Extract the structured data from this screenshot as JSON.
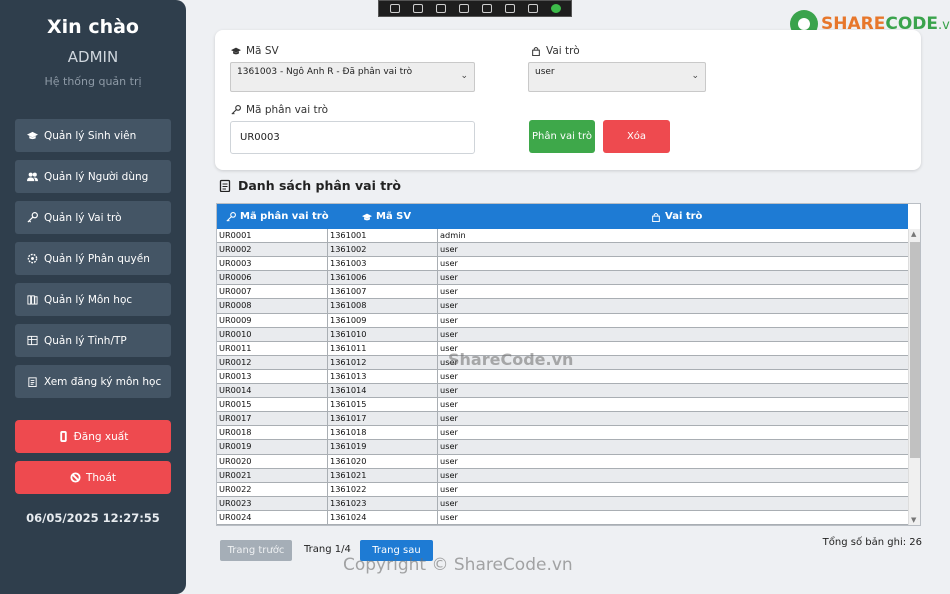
{
  "sidebar": {
    "greeting": "Xin chào",
    "user": "ADMIN",
    "subtitle": "Hệ thống quản trị",
    "items": [
      {
        "label": "Quản lý Sinh viên",
        "icon": "graduation-cap-icon"
      },
      {
        "label": "Quản lý Người dùng",
        "icon": "users-icon"
      },
      {
        "label": "Quản lý Vai trò",
        "icon": "key-icon"
      },
      {
        "label": "Quản lý Phân quyền",
        "icon": "gear-icon"
      },
      {
        "label": "Quản lý Môn học",
        "icon": "books-icon"
      },
      {
        "label": "Quản lý Tỉnh/TP",
        "icon": "map-icon"
      },
      {
        "label": "Xem đăng ký môn học",
        "icon": "clipboard-icon"
      }
    ],
    "logout_label": "Đăng xuất",
    "exit_label": "Thoát",
    "clock": "06/05/2025 12:27:55"
  },
  "logo": {
    "share": "SHARE",
    "code": "CODE",
    "domain": ".vn"
  },
  "form": {
    "student_label": "Mã SV",
    "student_value": "1361003 - Ngô Anh R - Đã phân vai trò",
    "role_label": "Vai trò",
    "role_value": "user",
    "assign_id_label": "Mã phân vai trò",
    "assign_id_value": "UR0003",
    "assign_button": "Phân vai trò",
    "delete_button": "Xóa"
  },
  "list": {
    "title": "Danh sách phân vai trò",
    "columns": [
      "Mã phân vai trò",
      "Mã SV",
      "Vai trò"
    ],
    "rows": [
      [
        "UR0001",
        "1361001",
        "admin"
      ],
      [
        "UR0002",
        "1361002",
        "user"
      ],
      [
        "UR0003",
        "1361003",
        "user"
      ],
      [
        "UR0006",
        "1361006",
        "user"
      ],
      [
        "UR0007",
        "1361007",
        "user"
      ],
      [
        "UR0008",
        "1361008",
        "user"
      ],
      [
        "UR0009",
        "1361009",
        "user"
      ],
      [
        "UR0010",
        "1361010",
        "user"
      ],
      [
        "UR0011",
        "1361011",
        "user"
      ],
      [
        "UR0012",
        "1361012",
        "user"
      ],
      [
        "UR0013",
        "1361013",
        "user"
      ],
      [
        "UR0014",
        "1361014",
        "user"
      ],
      [
        "UR0015",
        "1361015",
        "user"
      ],
      [
        "UR0017",
        "1361017",
        "user"
      ],
      [
        "UR0018",
        "1361018",
        "user"
      ],
      [
        "UR0019",
        "1361019",
        "user"
      ],
      [
        "UR0020",
        "1361020",
        "user"
      ],
      [
        "UR0021",
        "1361021",
        "user"
      ],
      [
        "UR0022",
        "1361022",
        "user"
      ],
      [
        "UR0023",
        "1361023",
        "user"
      ],
      [
        "UR0024",
        "1361024",
        "user"
      ]
    ]
  },
  "pagination": {
    "prev_label": "Trang trước",
    "page_label": "Trang 1/4",
    "next_label": "Trang sau",
    "total_label": "Tổng số bản ghi: 26"
  },
  "watermarks": {
    "center": "ShareCode.vn",
    "bottom": "Copyright © ShareCode.vn"
  },
  "colors": {
    "sidebar_bg": "#2f3e4c",
    "accent_blue": "#1e7bd4",
    "danger_red": "#ee4a4f",
    "success_green": "#3ea84a"
  }
}
